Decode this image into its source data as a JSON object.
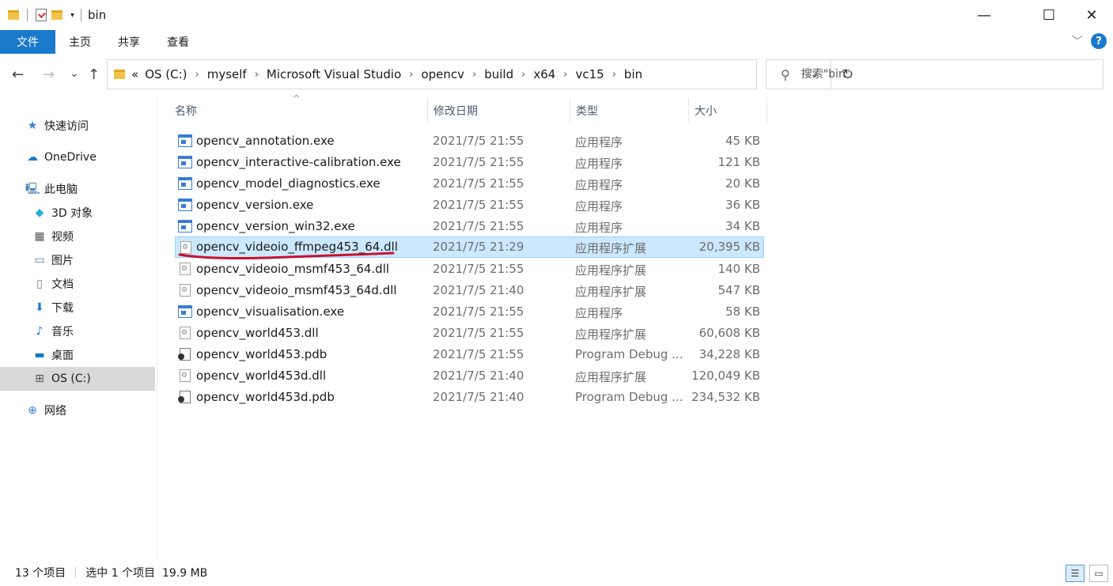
{
  "window": {
    "title": "bin",
    "minimize": "—",
    "maximize": "☐",
    "close": "✕"
  },
  "ribbon": {
    "tabs": [
      "文件",
      "主页",
      "共享",
      "查看"
    ],
    "expand": "﹀",
    "help": "?"
  },
  "nav": {
    "back": "←",
    "forward": "→",
    "recent": "⌄",
    "up": "↑",
    "refresh": "↻",
    "dropdown": "⌄"
  },
  "address": {
    "overflow": "«",
    "crumbs": [
      "OS (C:)",
      "myself",
      "Microsoft Visual Studio",
      "opencv",
      "build",
      "x64",
      "vc15",
      "bin"
    ],
    "separator": "›"
  },
  "search": {
    "placeholder": "搜索\"bin\""
  },
  "sidebar": {
    "items": [
      {
        "label": "快速访问",
        "icon": "star-icon"
      },
      {
        "label": "OneDrive",
        "icon": "cloud-icon"
      },
      {
        "label": "此电脑",
        "icon": "computer-icon"
      },
      {
        "label": "3D 对象",
        "icon": "cube-icon"
      },
      {
        "label": "视频",
        "icon": "video-icon"
      },
      {
        "label": "图片",
        "icon": "picture-icon"
      },
      {
        "label": "文档",
        "icon": "document-icon"
      },
      {
        "label": "下载",
        "icon": "download-icon"
      },
      {
        "label": "音乐",
        "icon": "music-icon"
      },
      {
        "label": "桌面",
        "icon": "desktop-icon"
      },
      {
        "label": "OS (C:)",
        "icon": "drive-icon",
        "selected": true
      },
      {
        "label": "网络",
        "icon": "network-icon"
      }
    ]
  },
  "columns": {
    "name": "名称",
    "date": "修改日期",
    "type": "类型",
    "size": "大小",
    "sort_caret": "^"
  },
  "files": [
    {
      "name": "opencv_annotation.exe",
      "date": "2021/7/5 21:55",
      "type": "应用程序",
      "size": "45 KB",
      "kind": "exe"
    },
    {
      "name": "opencv_interactive-calibration.exe",
      "date": "2021/7/5 21:55",
      "type": "应用程序",
      "size": "121 KB",
      "kind": "exe"
    },
    {
      "name": "opencv_model_diagnostics.exe",
      "date": "2021/7/5 21:55",
      "type": "应用程序",
      "size": "20 KB",
      "kind": "exe"
    },
    {
      "name": "opencv_version.exe",
      "date": "2021/7/5 21:55",
      "type": "应用程序",
      "size": "36 KB",
      "kind": "exe"
    },
    {
      "name": "opencv_version_win32.exe",
      "date": "2021/7/5 21:55",
      "type": "应用程序",
      "size": "34 KB",
      "kind": "exe"
    },
    {
      "name": "opencv_videoio_ffmpeg453_64.dll",
      "date": "2021/7/5 21:29",
      "type": "应用程序扩展",
      "size": "20,395 KB",
      "kind": "dll",
      "selected": true
    },
    {
      "name": "opencv_videoio_msmf453_64.dll",
      "date": "2021/7/5 21:55",
      "type": "应用程序扩展",
      "size": "140 KB",
      "kind": "dll"
    },
    {
      "name": "opencv_videoio_msmf453_64d.dll",
      "date": "2021/7/5 21:40",
      "type": "应用程序扩展",
      "size": "547 KB",
      "kind": "dll"
    },
    {
      "name": "opencv_visualisation.exe",
      "date": "2021/7/5 21:55",
      "type": "应用程序",
      "size": "58 KB",
      "kind": "exe"
    },
    {
      "name": "opencv_world453.dll",
      "date": "2021/7/5 21:55",
      "type": "应用程序扩展",
      "size": "60,608 KB",
      "kind": "dll"
    },
    {
      "name": "opencv_world453.pdb",
      "date": "2021/7/5 21:55",
      "type": "Program Debug ...",
      "size": "34,228 KB",
      "kind": "pdb"
    },
    {
      "name": "opencv_world453d.dll",
      "date": "2021/7/5 21:40",
      "type": "应用程序扩展",
      "size": "120,049 KB",
      "kind": "dll"
    },
    {
      "name": "opencv_world453d.pdb",
      "date": "2021/7/5 21:40",
      "type": "Program Debug ...",
      "size": "234,532 KB",
      "kind": "pdb"
    }
  ],
  "status": {
    "count": "13 个项目",
    "selection": "选中 1 个项目  19.9 MB"
  },
  "colors": {
    "accent": "#1979ca",
    "selected_row": "#cce8ff",
    "annotation": "#c8102e"
  }
}
